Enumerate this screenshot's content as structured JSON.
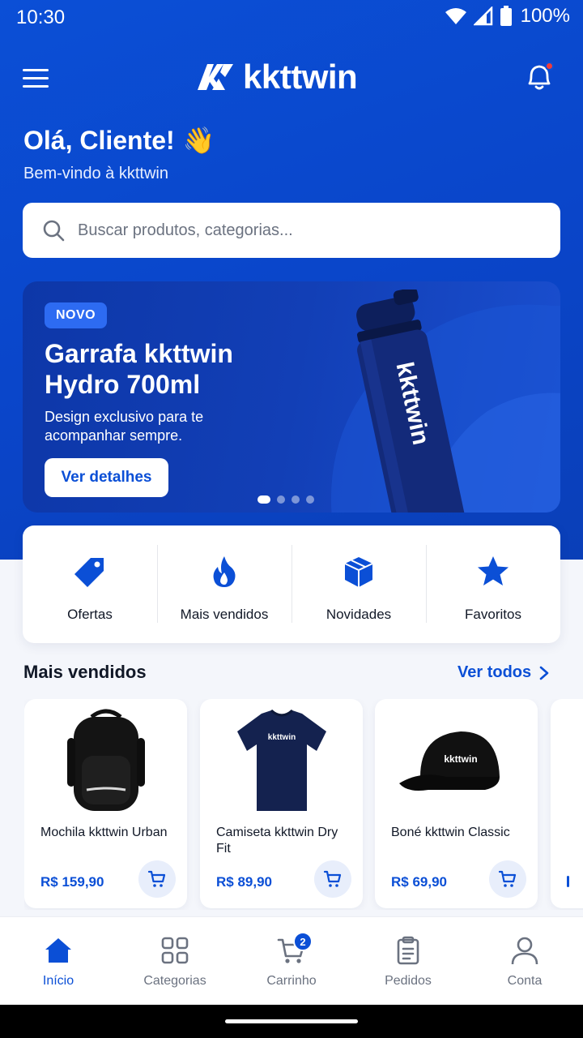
{
  "status_bar": {
    "time": "10:30",
    "battery": "100%"
  },
  "header": {
    "brand": "kkttwin",
    "notification_dot_color": "#ef3b3b"
  },
  "greeting": {
    "title": "Olá, Cliente!",
    "emoji": "👋",
    "subtitle": "Bem-vindo à kkttwin"
  },
  "search": {
    "placeholder": "Buscar produtos, categorias..."
  },
  "banner": {
    "badge": "NOVO",
    "title": "Garrafa kkttwin Hydro 700ml",
    "description": "Design exclusivo para te acompanhar sempre.",
    "button_label": "Ver detalhes",
    "slide_count": 4,
    "active_slide": 1
  },
  "quick_categories": [
    {
      "label": "Ofertas",
      "icon": "tag-icon"
    },
    {
      "label": "Mais vendidos",
      "icon": "fire-icon"
    },
    {
      "label": "Novidades",
      "icon": "box-icon"
    },
    {
      "label": "Favoritos",
      "icon": "star-icon"
    }
  ],
  "best_sellers": {
    "title": "Mais vendidos",
    "see_all": "Ver todos",
    "products": [
      {
        "name": "Mochila kkttwin Urban",
        "price": "R$ 159,90",
        "image": "backpack-image"
      },
      {
        "name": "Camiseta kkttwin Dry Fit",
        "price": "R$ 89,90",
        "image": "tshirt-image",
        "print": "kkttwin"
      },
      {
        "name": "Boné kkttwin Classic",
        "price": "R$ 69,90",
        "image": "cap-image",
        "print": "kkttwin"
      }
    ]
  },
  "bottom_nav": [
    {
      "label": "Início",
      "icon": "home-icon",
      "active": true
    },
    {
      "label": "Categorias",
      "icon": "grid-icon",
      "active": false
    },
    {
      "label": "Carrinho",
      "icon": "cart-icon",
      "active": false,
      "badge": "2"
    },
    {
      "label": "Pedidos",
      "icon": "clipboard-icon",
      "active": false
    },
    {
      "label": "Conta",
      "icon": "user-icon",
      "active": false
    }
  ],
  "colors": {
    "primary": "#0b4fd6",
    "price": "#0b4fd6",
    "badge": "#2d6bf2"
  }
}
